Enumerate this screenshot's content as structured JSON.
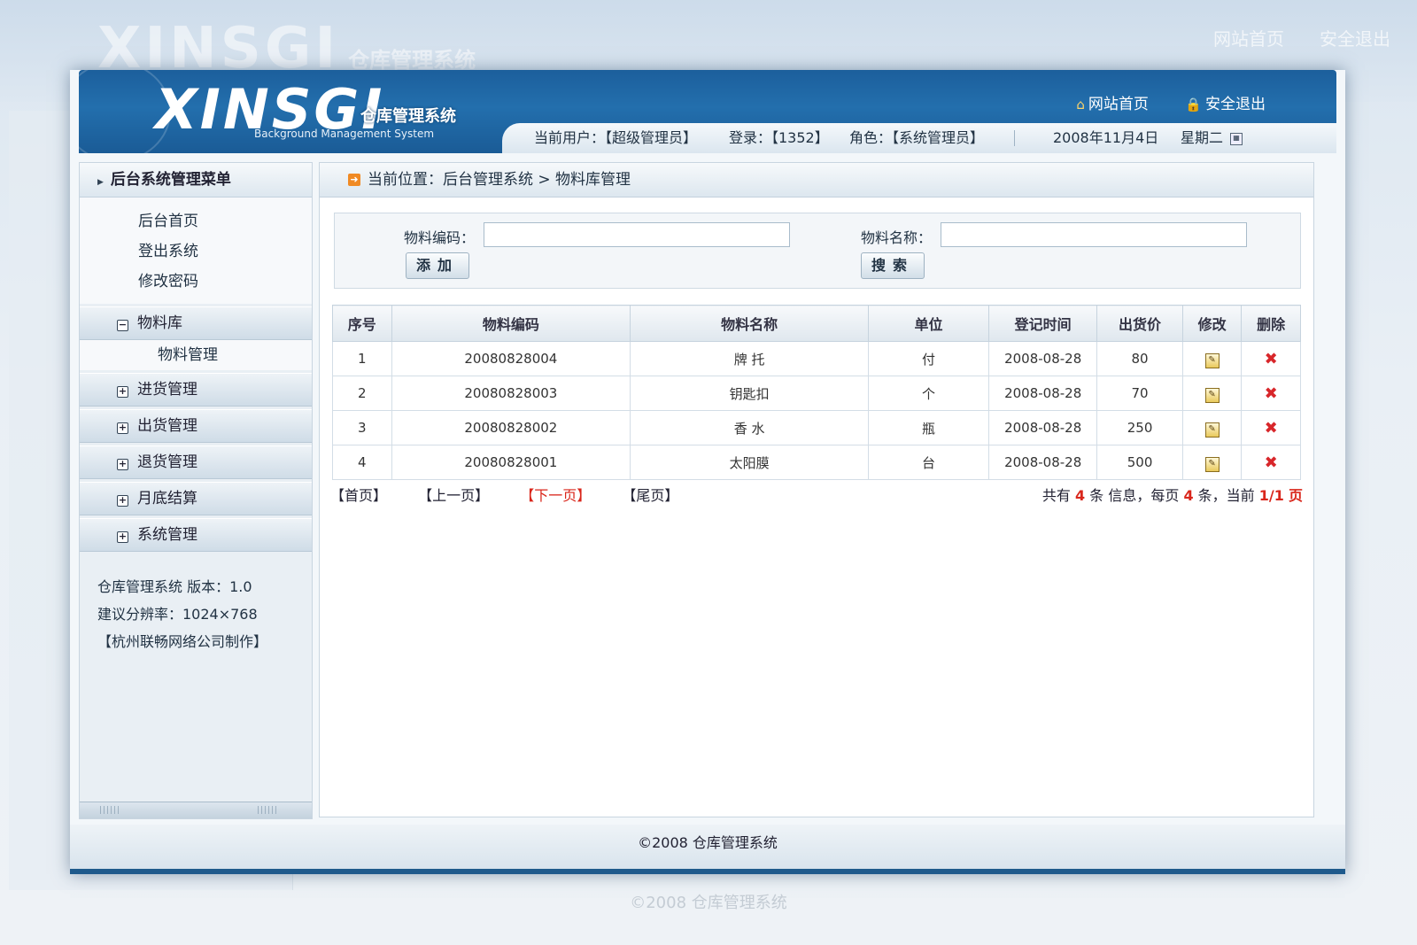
{
  "brand": {
    "logo": "XINSGI",
    "subtitle": "仓库管理系统",
    "en": "Background Management System"
  },
  "top_links": {
    "home": "网站首页",
    "logout": "安全退出"
  },
  "userbar": {
    "user": "当前用户：【超级管理员】",
    "login": "登录：【1352】",
    "role": "角色：【系统管理员】",
    "date": "2008年11月4日",
    "weekday": "星期二"
  },
  "sidebar": {
    "title": "后台系统管理菜单",
    "links": [
      "后台首页",
      "登出系统",
      "修改密码"
    ],
    "menu": [
      {
        "label": "物料库",
        "expanded": true,
        "children": [
          "物料管理"
        ]
      },
      {
        "label": "进货管理",
        "expanded": false
      },
      {
        "label": "出货管理",
        "expanded": false
      },
      {
        "label": "退货管理",
        "expanded": false
      },
      {
        "label": "月底结算",
        "expanded": false
      },
      {
        "label": "系统管理",
        "expanded": false
      }
    ],
    "info": [
      "仓库管理系统  版本：1.0",
      "建议分辨率：1024×768",
      "【杭州联畅网络公司制作】"
    ]
  },
  "breadcrumb": "当前位置：后台管理系统 > 物料库管理",
  "search": {
    "code_label": "物料编码：",
    "code_value": "",
    "name_label": "物料名称：",
    "name_value": "",
    "add_button": "添加",
    "search_button": "搜索"
  },
  "table": {
    "headers": [
      "序号",
      "物料编码",
      "物料名称",
      "单位",
      "登记时间",
      "出货价",
      "修改",
      "删除"
    ],
    "rows": [
      {
        "no": "1",
        "code": "20080828004",
        "name": "牌 托",
        "unit": "付",
        "date": "2008-08-28",
        "price": "80"
      },
      {
        "no": "2",
        "code": "20080828003",
        "name": "钥匙扣",
        "unit": "个",
        "date": "2008-08-28",
        "price": "70"
      },
      {
        "no": "3",
        "code": "20080828002",
        "name": "香 水",
        "unit": "瓶",
        "date": "2008-08-28",
        "price": "250"
      },
      {
        "no": "4",
        "code": "20080828001",
        "name": "太阳膜",
        "unit": "台",
        "date": "2008-08-28",
        "price": "500"
      }
    ]
  },
  "pager": {
    "first": "【首页】",
    "prev": "【上一页】",
    "next": "【下一页】",
    "last": "【尾页】",
    "info_prefix": "共有",
    "total": "4",
    "info_mid1": "条 信息，每页",
    "per_page": "4",
    "info_mid2": "条，当前",
    "page": "1/1",
    "info_suffix": "页"
  },
  "footer": "©2008 仓库管理系统",
  "colors": {
    "header": "#1f64a3",
    "accent": "#d9261b"
  }
}
